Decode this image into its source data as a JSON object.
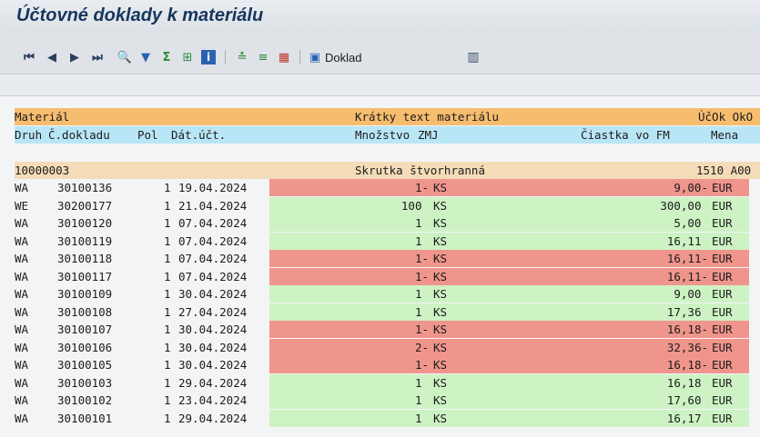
{
  "title": "Účtovné doklady k materiálu",
  "toolbar": {
    "doklad_label": "Doklad",
    "icons": [
      "first-page-icon",
      "prev-page-icon",
      "next-page-icon",
      "last-page-icon",
      "details-icon",
      "filter-icon",
      "sum-icon",
      "subtotal-icon",
      "info-icon",
      "sort-asc-icon",
      "sort-desc-icon",
      "calendar-icon",
      "document-icon",
      "layout-icon"
    ]
  },
  "header": {
    "line1": {
      "material": "Materiál",
      "text": "Krátky text materiálu",
      "right": "ÚčOk OkO"
    },
    "line2": {
      "druh": "Druh",
      "cislo": "Č.dokladu",
      "pol": "Pol",
      "datum": "Dát.účt.",
      "mnozstvo": "Množstvo",
      "zmj": "ZMJ",
      "ciastka": "Čiastka vo FM",
      "mena": "Mena"
    }
  },
  "group": {
    "material": "10000003",
    "text": "Skrutka štvorhranná",
    "right": "1510 A00"
  },
  "rows": [
    {
      "druh": "WA",
      "cislo": "30100136",
      "pol": "1",
      "datum": "19.04.2024",
      "mnozstvo": "1-",
      "zmj": "KS",
      "ciastka": "9,00-",
      "mena": "EUR",
      "status": "negative"
    },
    {
      "druh": "WE",
      "cislo": "30200177",
      "pol": "1",
      "datum": "21.04.2024",
      "mnozstvo": "100 ",
      "zmj": "KS",
      "ciastka": "300,00 ",
      "mena": "EUR",
      "status": "positive"
    },
    {
      "druh": "WA",
      "cislo": "30100120",
      "pol": "1",
      "datum": "07.04.2024",
      "mnozstvo": "1 ",
      "zmj": "KS",
      "ciastka": "5,00 ",
      "mena": "EUR",
      "status": "positive"
    },
    {
      "druh": "WA",
      "cislo": "30100119",
      "pol": "1",
      "datum": "07.04.2024",
      "mnozstvo": "1 ",
      "zmj": "KS",
      "ciastka": "16,11 ",
      "mena": "EUR",
      "status": "positive"
    },
    {
      "druh": "WA",
      "cislo": "30100118",
      "pol": "1",
      "datum": "07.04.2024",
      "mnozstvo": "1-",
      "zmj": "KS",
      "ciastka": "16,11-",
      "mena": "EUR",
      "status": "negative"
    },
    {
      "druh": "WA",
      "cislo": "30100117",
      "pol": "1",
      "datum": "07.04.2024",
      "mnozstvo": "1-",
      "zmj": "KS",
      "ciastka": "16,11-",
      "mena": "EUR",
      "status": "negative"
    },
    {
      "druh": "WA",
      "cislo": "30100109",
      "pol": "1",
      "datum": "30.04.2024",
      "mnozstvo": "1 ",
      "zmj": "KS",
      "ciastka": "9,00 ",
      "mena": "EUR",
      "status": "positive"
    },
    {
      "druh": "WA",
      "cislo": "30100108",
      "pol": "1",
      "datum": "27.04.2024",
      "mnozstvo": "1 ",
      "zmj": "KS",
      "ciastka": "17,36 ",
      "mena": "EUR",
      "status": "positive"
    },
    {
      "druh": "WA",
      "cislo": "30100107",
      "pol": "1",
      "datum": "30.04.2024",
      "mnozstvo": "1-",
      "zmj": "KS",
      "ciastka": "16,18-",
      "mena": "EUR",
      "status": "negative"
    },
    {
      "druh": "WA",
      "cislo": "30100106",
      "pol": "1",
      "datum": "30.04.2024",
      "mnozstvo": "2-",
      "zmj": "KS",
      "ciastka": "32,36-",
      "mena": "EUR",
      "status": "negative"
    },
    {
      "druh": "WA",
      "cislo": "30100105",
      "pol": "1",
      "datum": "30.04.2024",
      "mnozstvo": "1-",
      "zmj": "KS",
      "ciastka": "16,18-",
      "mena": "EUR",
      "status": "negative"
    },
    {
      "druh": "WA",
      "cislo": "30100103",
      "pol": "1",
      "datum": "29.04.2024",
      "mnozstvo": "1 ",
      "zmj": "KS",
      "ciastka": "16,18 ",
      "mena": "EUR",
      "status": "positive"
    },
    {
      "druh": "WA",
      "cislo": "30100102",
      "pol": "1",
      "datum": "23.04.2024",
      "mnozstvo": "1 ",
      "zmj": "KS",
      "ciastka": "17,60 ",
      "mena": "EUR",
      "status": "positive"
    },
    {
      "druh": "WA",
      "cislo": "30100101",
      "pol": "1",
      "datum": "29.04.2024",
      "mnozstvo": "1 ",
      "zmj": "KS",
      "ciastka": "16,17 ",
      "mena": "EUR",
      "status": "positive"
    }
  ],
  "colors": {
    "header1": "#f6bd6f",
    "header2": "#b9e6f6",
    "group": "#f5dcb8",
    "negative": "#f0958c",
    "positive": "#cdf3c4"
  }
}
